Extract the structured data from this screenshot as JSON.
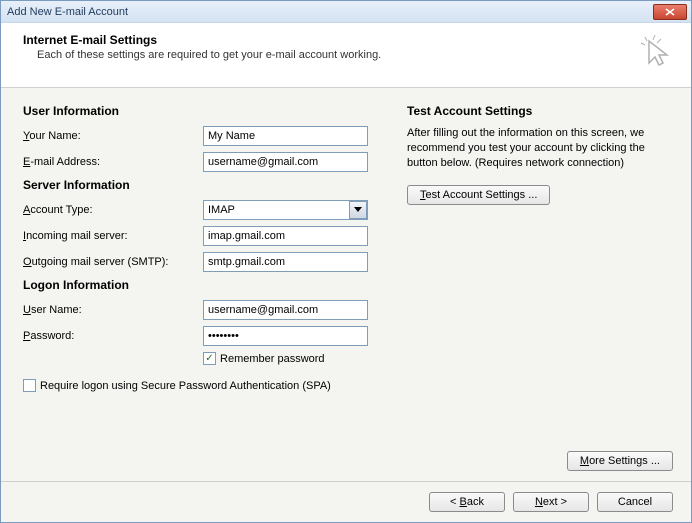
{
  "window": {
    "title": "Add New E-mail Account"
  },
  "header": {
    "title": "Internet E-mail Settings",
    "subtitle": "Each of these settings are required to get your e-mail account working."
  },
  "sections": {
    "user_info": "User Information",
    "server_info": "Server Information",
    "logon_info": "Logon Information",
    "test": "Test Account Settings"
  },
  "labels": {
    "your_name_pre": "Y",
    "your_name_rest": "our Name:",
    "email_pre": "E",
    "email_rest": "-mail Address:",
    "account_type_pre": "A",
    "account_type_rest": "ccount Type:",
    "incoming_pre": "I",
    "incoming_rest": "ncoming mail server:",
    "outgoing_pre": "O",
    "outgoing_rest": "utgoing mail server (SMTP):",
    "username_pre": "U",
    "username_rest": "ser Name:",
    "password_pre": "P",
    "password_rest": "assword:",
    "remember_pre": "R",
    "remember_rest": "emember password",
    "spa": "Require logon using Secure Password Authentication (SPA)"
  },
  "values": {
    "your_name": "My Name",
    "email": "username@gmail.com",
    "account_type": "IMAP",
    "incoming": "imap.gmail.com",
    "outgoing": "smtp.gmail.com",
    "username": "username@gmail.com",
    "password": "********"
  },
  "right": {
    "text": "After filling out the information on this screen, we recommend you test your account by clicking the button below. (Requires network connection)",
    "test_btn_pre": "T",
    "test_btn_rest": "est Account Settings ...",
    "more_pre": "M",
    "more_rest": "ore Settings ..."
  },
  "footer": {
    "back_pre": "< ",
    "back_u": "B",
    "back_rest": "ack",
    "next_pre": "",
    "next_u": "N",
    "next_rest": "ext >",
    "cancel": "Cancel"
  },
  "remember_checked": "✓"
}
